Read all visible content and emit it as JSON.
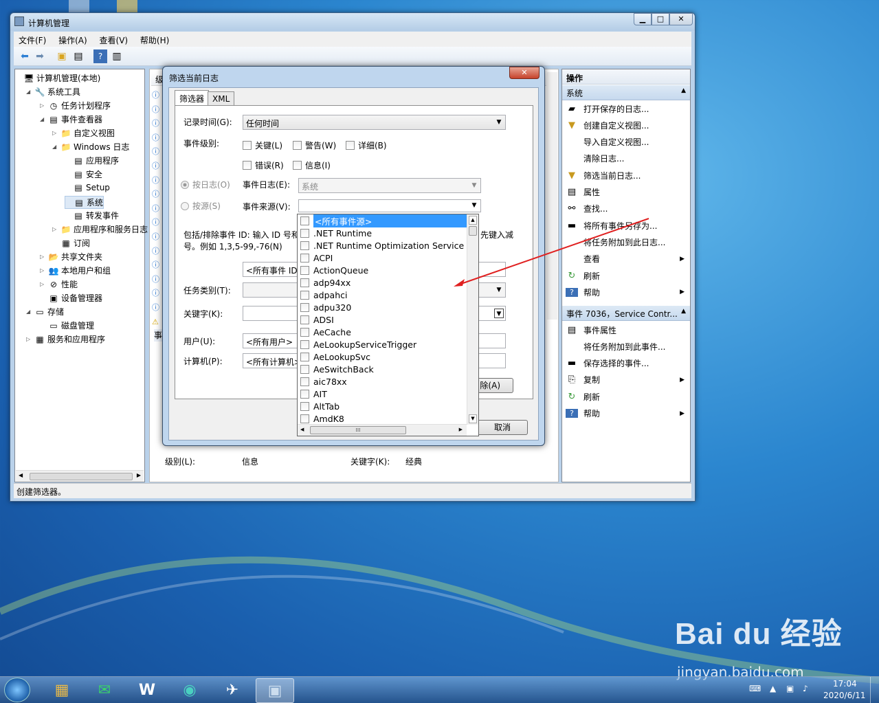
{
  "window": {
    "title": "计算机管理",
    "status": "创建筛选器。"
  },
  "menu": [
    "文件(F)",
    "操作(A)",
    "查看(V)",
    "帮助(H)"
  ],
  "tree": [
    {
      "label": "计算机管理(本地)",
      "icon": "computer-icon"
    },
    {
      "label": "系统工具",
      "icon": "tools-icon"
    },
    {
      "label": "任务计划程序",
      "icon": "clock-icon"
    },
    {
      "label": "事件查看器",
      "icon": "event-viewer-icon"
    },
    {
      "label": "自定义视图",
      "icon": "folder-icon"
    },
    {
      "label": "Windows 日志",
      "icon": "folder-icon"
    },
    {
      "label": "应用程序",
      "icon": "log-icon"
    },
    {
      "label": "安全",
      "icon": "log-icon"
    },
    {
      "label": "Setup",
      "icon": "log-icon"
    },
    {
      "label": "系统",
      "icon": "log-icon"
    },
    {
      "label": "转发事件",
      "icon": "log-icon"
    },
    {
      "label": "应用程序和服务日志",
      "icon": "folder-icon"
    },
    {
      "label": "订阅",
      "icon": "subscription-icon"
    },
    {
      "label": "共享文件夹",
      "icon": "shared-folder-icon"
    },
    {
      "label": "本地用户和组",
      "icon": "users-icon"
    },
    {
      "label": "性能",
      "icon": "performance-icon"
    },
    {
      "label": "设备管理器",
      "icon": "device-icon"
    },
    {
      "label": "存储",
      "icon": "storage-icon"
    },
    {
      "label": "磁盘管理",
      "icon": "disk-icon"
    },
    {
      "label": "服务和应用程序",
      "icon": "services-icon"
    }
  ],
  "center": {
    "level_label": "级别(L):",
    "level_value": "信息",
    "keyword_label": "关键字(K):",
    "keyword_value": "经典",
    "col_head": "级",
    "tab_head": "事"
  },
  "actions": {
    "header": "操作",
    "section1": "系统",
    "items1": [
      "打开保存的日志...",
      "创建自定义视图...",
      "导入自定义视图...",
      "清除日志...",
      "筛选当前日志...",
      "属性",
      "查找...",
      "将所有事件另存为...",
      "将任务附加到此日志...",
      "查看",
      "刷新",
      "帮助"
    ],
    "section2": "事件 7036，Service Contr...",
    "items2": [
      "事件属性",
      "将任务附加到此事件...",
      "保存选择的事件...",
      "复制",
      "刷新",
      "帮助"
    ]
  },
  "dialog": {
    "title": "筛选当前日志",
    "tabs": [
      "筛选器",
      "XML"
    ],
    "logged_label": "记录时间(G):",
    "logged_value": "任何时间",
    "level_label": "事件级别:",
    "levels": [
      "关键(L)",
      "警告(W)",
      "详细(B)",
      "错误(R)",
      "信息(I)"
    ],
    "by_log": "按日志(O)",
    "event_log_label": "事件日志(E):",
    "event_log_value": "系统",
    "by_source": "按源(S)",
    "source_label": "事件来源(V):",
    "include_text": "包括/排除事件 ID: 输入 ID 号和/或 ID 范围，使用逗号分隔。若要排除条件，请先键入减号。例如 1,3,5-99,-76(N)",
    "include_line1": "包括/排除事件 ID: 输入 ID 号和",
    "include_tail": "先键入减",
    "include_line2": "号。例如 1,3,5-99,-76(N)",
    "event_id_value": "<所有事件 ID>",
    "task_label": "任务类别(T):",
    "keyword_label": "关键字(K):",
    "user_label": "用户(U):",
    "user_value": "<所有用户>",
    "computer_label": "计算机(P):",
    "computer_value": "<所有计算机>",
    "clear_label": "除(A)",
    "cancel_label": "取消"
  },
  "sources": [
    "<所有事件源>",
    ".NET Runtime",
    ".NET Runtime Optimization Service",
    "ACPI",
    "ActionQueue",
    "adp94xx",
    "adpahci",
    "adpu320",
    "ADSI",
    "AeCache",
    "AeLookupServiceTrigger",
    "AeLookupSvc",
    "AeSwitchBack",
    "aic78xx",
    "AIT",
    "AltTab",
    "AmdK8"
  ],
  "clock": {
    "time": "17:04",
    "date": "2020/6/11"
  },
  "watermark": {
    "brand": "Bai du 经验",
    "url": "jingyan.baidu.com"
  },
  "colors": {
    "accent": "#3399ff",
    "annotation_arrow": "#e02020"
  }
}
